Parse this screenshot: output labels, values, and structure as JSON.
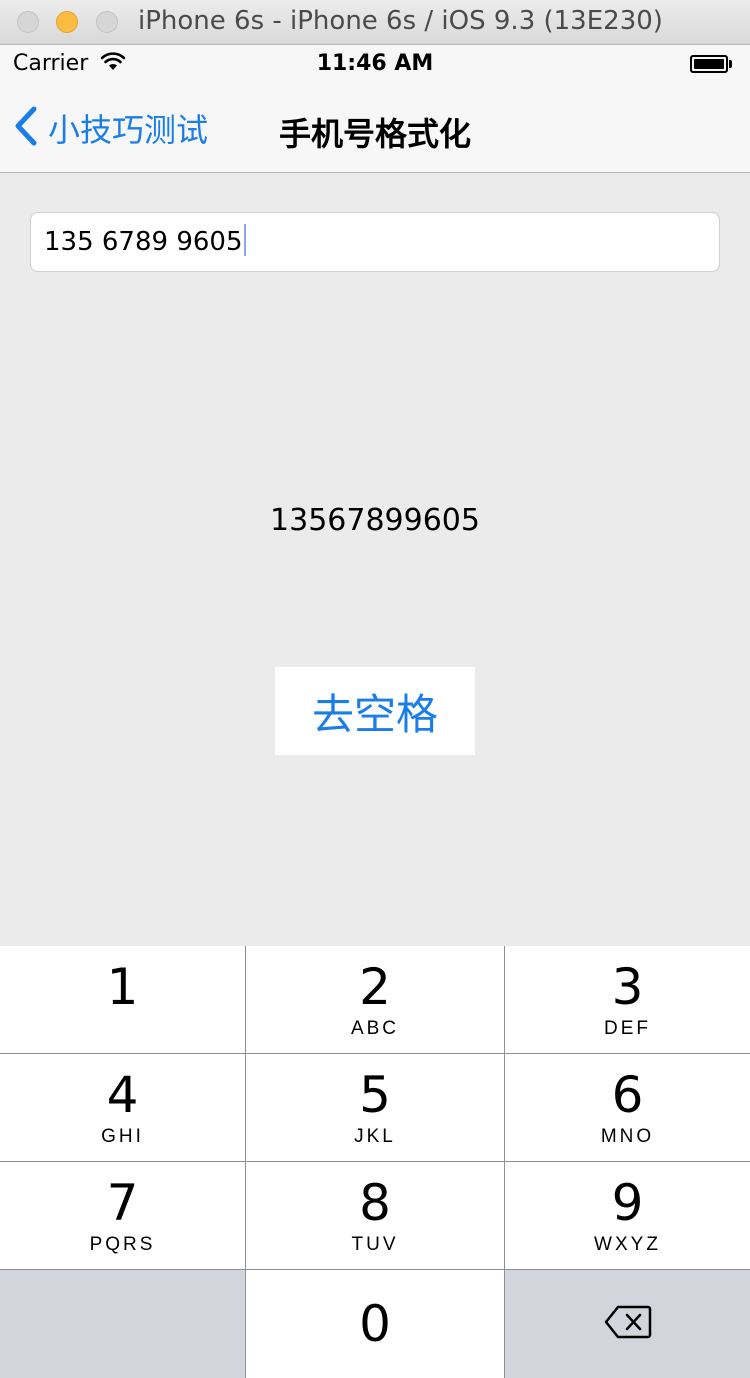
{
  "window": {
    "title": "iPhone 6s - iPhone 6s / iOS 9.3 (13E230)"
  },
  "status_bar": {
    "carrier": "Carrier",
    "time": "11:46 AM"
  },
  "nav": {
    "back_label": "小技巧测试",
    "title": "手机号格式化"
  },
  "main": {
    "phone_input_value": "135 6789 9605",
    "result_text": "13567899605",
    "strip_button_label": "去空格"
  },
  "keypad": {
    "keys": [
      {
        "digit": "1",
        "letters": ""
      },
      {
        "digit": "2",
        "letters": "ABC"
      },
      {
        "digit": "3",
        "letters": "DEF"
      },
      {
        "digit": "4",
        "letters": "GHI"
      },
      {
        "digit": "5",
        "letters": "JKL"
      },
      {
        "digit": "6",
        "letters": "MNO"
      },
      {
        "digit": "7",
        "letters": "PQRS"
      },
      {
        "digit": "8",
        "letters": "TUV"
      },
      {
        "digit": "9",
        "letters": "WXYZ"
      },
      {
        "digit": "0",
        "letters": ""
      }
    ],
    "delete_icon": "backspace-icon"
  },
  "colors": {
    "accent": "#1a7ee8",
    "background": "#ebebeb",
    "keypad_gray": "#d2d5db"
  }
}
